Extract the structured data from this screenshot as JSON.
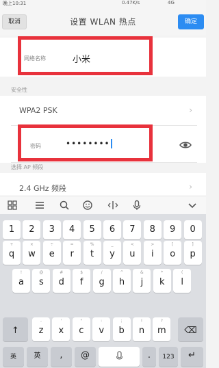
{
  "status_bar": {
    "time": "晚上10:31",
    "speed": "0.47K/s",
    "network": "4G"
  },
  "header": {
    "cancel_label": "取消",
    "title": "设置 WLAN 热点",
    "confirm_label": "确定"
  },
  "network_name": {
    "label": "网络名称",
    "value": "小米"
  },
  "security": {
    "section_title": "安全性",
    "value": "WPA2 PSK"
  },
  "password": {
    "label": "密码",
    "value": "••••••••"
  },
  "ap_band": {
    "section_title": "选择 AP 频段",
    "value": "2.4 GHz 频段"
  },
  "keyboard": {
    "toolbar_icons": [
      "grid-icon",
      "menu-icon",
      "search-icon",
      "emoji-icon",
      "cursor-icon",
      "microphone-icon",
      "collapse-icon"
    ],
    "number_row": [
      "1",
      "2",
      "3",
      "4",
      "5",
      "6",
      "7",
      "8",
      "9",
      "0"
    ],
    "row1": [
      {
        "main": "q",
        "sub": "+"
      },
      {
        "main": "w",
        "sub": "×"
      },
      {
        "main": "e",
        "sub": "÷"
      },
      {
        "main": "r",
        "sub": "="
      },
      {
        "main": "t",
        "sub": "%"
      },
      {
        "main": "y",
        "sub": "_"
      },
      {
        "main": "u",
        "sub": "<"
      },
      {
        "main": "i",
        "sub": ">"
      },
      {
        "main": "o",
        "sub": "["
      },
      {
        "main": "p",
        "sub": "]"
      }
    ],
    "row2": [
      {
        "main": "a",
        "sub": "!"
      },
      {
        "main": "s",
        "sub": "@"
      },
      {
        "main": "d",
        "sub": "#"
      },
      {
        "main": "f",
        "sub": "$"
      },
      {
        "main": "g",
        "sub": "/"
      },
      {
        "main": "h",
        "sub": "^"
      },
      {
        "main": "j",
        "sub": "&"
      },
      {
        "main": "k",
        "sub": "*"
      },
      {
        "main": "l",
        "sub": "("
      }
    ],
    "row3": [
      {
        "main": "z",
        "sub": "-"
      },
      {
        "main": "x",
        "sub": "'"
      },
      {
        "main": "c",
        "sub": "\""
      },
      {
        "main": "v",
        "sub": ":"
      },
      {
        "main": "b",
        "sub": ";"
      },
      {
        "main": "n",
        "sub": "!"
      },
      {
        "main": "m",
        "sub": "?"
      }
    ],
    "shift_label": "↑",
    "backspace_label": "⌫",
    "lang_label": "英",
    "comma_label": ",",
    "at_label": "@",
    "period_label": ".",
    "num_label": "123",
    "enter_label": "↵"
  }
}
